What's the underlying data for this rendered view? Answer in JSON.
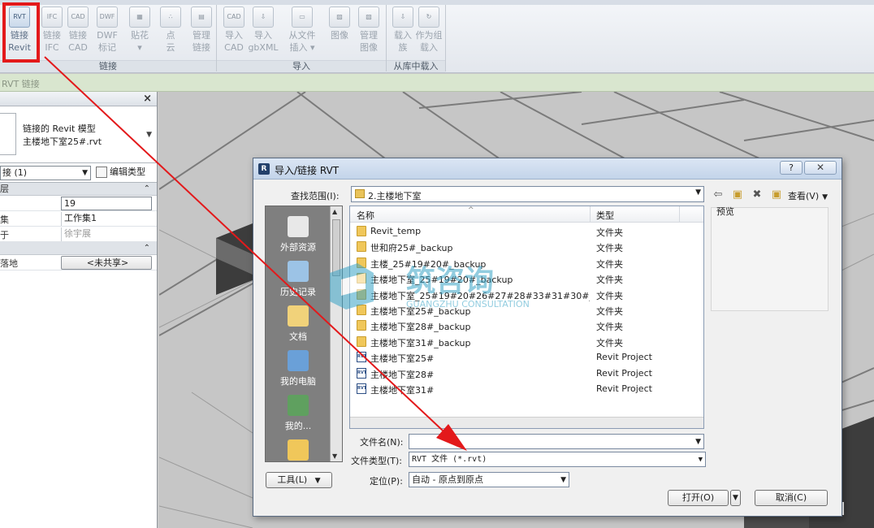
{
  "ribbon": {
    "buttons": [
      {
        "label1": "链接",
        "label2": "Revit",
        "icon": "RVT"
      },
      {
        "label1": "链接",
        "label2": "IFC",
        "icon": "IFC"
      },
      {
        "label1": "链接",
        "label2": "CAD",
        "icon": "CAD"
      },
      {
        "label1": "DWF",
        "label2": "标记",
        "icon": "DWF"
      },
      {
        "label1": "贴花",
        "label2": "▾",
        "icon": "▦"
      },
      {
        "label1": "点",
        "label2": "云",
        "icon": "∴"
      },
      {
        "label1": "管理",
        "label2": "链接",
        "icon": "▤"
      },
      {
        "label1": "导入",
        "label2": "CAD",
        "icon": "CAD"
      },
      {
        "label1": "导入",
        "label2": "gbXML",
        "icon": "⇩"
      },
      {
        "label1": "从文件",
        "label2": "插入 ▾",
        "icon": "▭"
      },
      {
        "label1": "图像",
        "label2": "",
        "icon": "▨"
      },
      {
        "label1": "管理",
        "label2": "图像",
        "icon": "▧"
      },
      {
        "label1": "载入",
        "label2": "族",
        "icon": "⇩"
      },
      {
        "label1": "作为组",
        "label2": "载入",
        "icon": "↻"
      }
    ],
    "panels": {
      "link": "链接",
      "import": "导入",
      "library": "从库中载入"
    }
  },
  "context_bar": {
    "text": "RVT 链接"
  },
  "properties": {
    "type_line1": "链接的 Revit 模型",
    "type_line2": "主楼地下室25#.rvt",
    "instance_selector": "接 (1)",
    "edit_type": "编辑类型",
    "group1": "层",
    "rows": [
      {
        "name": "",
        "value": "19"
      },
      {
        "name": "集",
        "value": "工作集1"
      },
      {
        "name": "于",
        "value": "徐宇展"
      }
    ],
    "group2": "",
    "row_site": {
      "name": "落地",
      "value": "<未共享>"
    }
  },
  "dialog": {
    "title": "导入/链接 RVT",
    "help": "?",
    "close": "✕",
    "lookin_label": "查找范围(I):",
    "lookin_value": "2.主楼地下室",
    "view_menu": "查看(V)",
    "places": [
      {
        "label": "外部资源",
        "color": "#e8e8e8"
      },
      {
        "label": "历史记录",
        "color": "#9cc3e6"
      },
      {
        "label": "文档",
        "color": "#f1d27a"
      },
      {
        "label": "我的电脑",
        "color": "#6aa0d8"
      },
      {
        "label": "我的...",
        "color": "#5fa05f"
      },
      {
        "label": "",
        "color": "#f0c75a"
      }
    ],
    "col_name": "名称",
    "col_type": "类型",
    "files": [
      {
        "name": "Revit_temp",
        "type": "文件夹",
        "kind": "folder"
      },
      {
        "name": "世和府25#_backup",
        "type": "文件夹",
        "kind": "folder"
      },
      {
        "name": "主楼_25#19#20#_backup",
        "type": "文件夹",
        "kind": "folder"
      },
      {
        "name": "主楼地下室_25#19#20#_backup",
        "type": "文件夹",
        "kind": "folder"
      },
      {
        "name": "主楼地下室_25#19#20#26#27#28#33#31#30#_backup",
        "type": "文件夹",
        "kind": "folder"
      },
      {
        "name": "主楼地下室25#_backup",
        "type": "文件夹",
        "kind": "folder"
      },
      {
        "name": "主楼地下室28#_backup",
        "type": "文件夹",
        "kind": "folder"
      },
      {
        "name": "主楼地下室31#_backup",
        "type": "文件夹",
        "kind": "folder"
      },
      {
        "name": "主楼地下室25#",
        "type": "Revit Project",
        "kind": "rvt"
      },
      {
        "name": "主楼地下室28#",
        "type": "Revit Project",
        "kind": "rvt"
      },
      {
        "name": "主楼地下室31#",
        "type": "Revit Project",
        "kind": "rvt"
      }
    ],
    "preview_label": "预览",
    "filename_label": "文件名(N):",
    "filename_value": "",
    "filetype_label": "文件类型(T):",
    "filetype_value": "RVT 文件 (*.rvt)",
    "tools_button": "工具(L)",
    "position_label": "定位(P):",
    "position_value": "自动 - 原点到原点",
    "open_button": "打开(O)",
    "cancel_button": "取消(C)"
  },
  "watermark": {
    "title": "筑咨询",
    "subtitle": "GUANGZHU CONSULTATION"
  },
  "colors": {
    "highlight": "#e3191b",
    "arrow": "#e3191b"
  }
}
